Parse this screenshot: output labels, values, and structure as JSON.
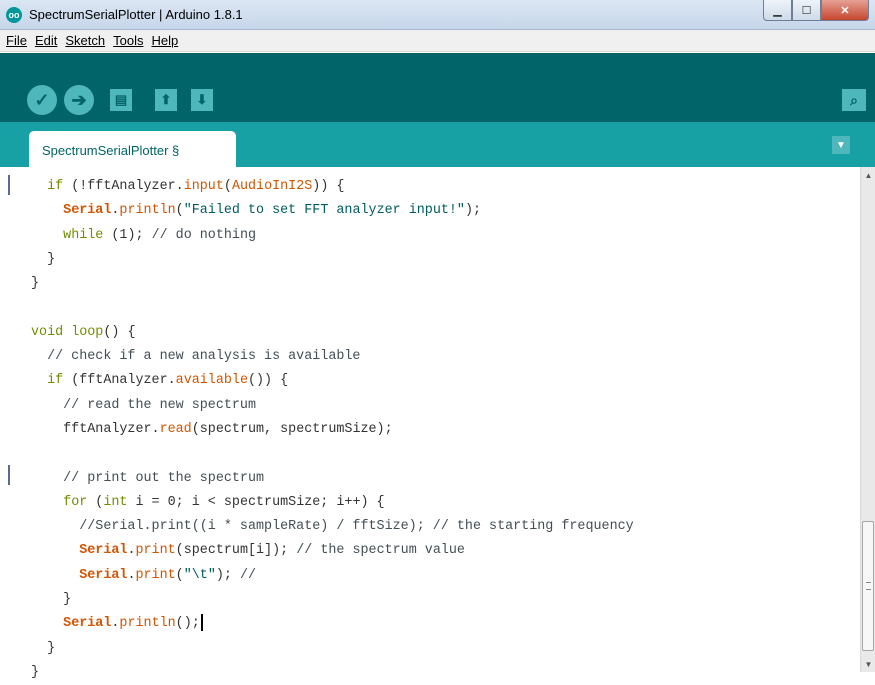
{
  "window": {
    "title": "SpectrumSerialPlotter | Arduino 1.8.1",
    "icon": "arduino-logo-icon",
    "controls": {
      "minimize": "▁",
      "maximize": "☐",
      "close": "✕"
    }
  },
  "menu": [
    "File",
    "Edit",
    "Sketch",
    "Tools",
    "Help"
  ],
  "toolbar": {
    "verify_icon": "✓",
    "upload_icon": "➔",
    "new_icon": "▤",
    "open_icon": "⬆",
    "save_icon": "⬇",
    "serial_monitor_icon": "⌕"
  },
  "tab": {
    "label": "SpectrumSerialPlotter §",
    "menu_icon": "▼"
  },
  "colors": {
    "toolbar": "#006468",
    "tabstrip": "#17a1a5",
    "keyword": "#728e00",
    "function": "#d35400"
  },
  "code": {
    "l01": [
      "  ",
      "if",
      " (!fftAnalyzer.",
      "input",
      "(",
      "AudioInI2S",
      ")) {"
    ],
    "l02": [
      "    ",
      "Serial",
      ".",
      "println",
      "(",
      "\"Failed to set FFT analyzer input!\"",
      ");"
    ],
    "l03": [
      "    ",
      "while",
      " (1); ",
      "// do nothing"
    ],
    "l04": "  }",
    "l05": "}",
    "l06": "",
    "l07": [
      "void",
      " ",
      "loop",
      "() {"
    ],
    "l08": "  // check if a new analysis is available",
    "l09": [
      "  ",
      "if",
      " (fftAnalyzer.",
      "available",
      "()) {"
    ],
    "l10": "    // read the new spectrum",
    "l11": [
      "    fftAnalyzer.",
      "read",
      "(spectrum, spectrumSize);"
    ],
    "l12": "",
    "l13": "    // print out the spectrum",
    "l14": [
      "    ",
      "for",
      " (",
      "int",
      " i = 0; i < spectrumSize; i++) {"
    ],
    "l15": "      //Serial.print((i * sampleRate) / fftSize); // the starting frequency",
    "l16": [
      "      ",
      "Serial",
      ".",
      "print",
      "(spectrum[i]); ",
      "// the spectrum value"
    ],
    "l17": [
      "      ",
      "Serial",
      ".",
      "print",
      "(",
      "\"\\t\"",
      "); ",
      "//"
    ],
    "l18": "    }",
    "l19": [
      "    ",
      "Serial",
      ".",
      "println",
      "();"
    ],
    "l20": "  }",
    "l21": "}"
  },
  "scrollbar": {
    "up": "▲",
    "down": "▼"
  }
}
